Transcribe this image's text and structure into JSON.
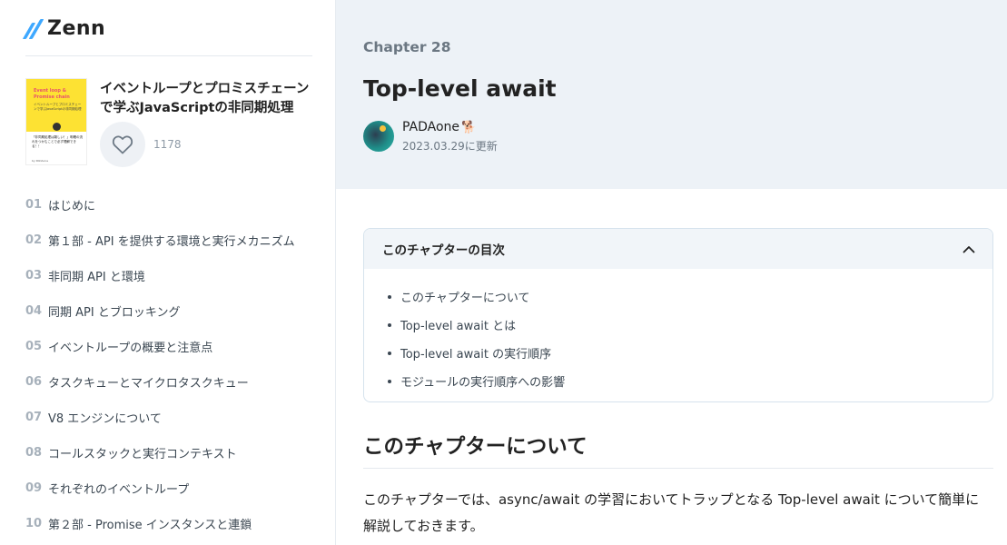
{
  "logo": {
    "text": "Zenn"
  },
  "book": {
    "cover_title": "Event loop & Promise chain",
    "cover_sub": "イベントループとプロミスチェーンで学ぶJavaScriptの非同期処理",
    "cover_quote": "「非同期処理は難しい！」明確の流れをつかむことで必ず理解できる！！",
    "cover_author": "by PADAone",
    "title": "イベントループとプロミスチェーンで学ぶJavaScriptの非同期処理",
    "like_count": "1178"
  },
  "sidebar": {
    "items": [
      {
        "num": "01",
        "label": "はじめに"
      },
      {
        "num": "02",
        "label": "第１部 - API を提供する環境と実行メカニズム"
      },
      {
        "num": "03",
        "label": "非同期 API と環境"
      },
      {
        "num": "04",
        "label": "同期 API とブロッキング"
      },
      {
        "num": "05",
        "label": "イベントループの概要と注意点"
      },
      {
        "num": "06",
        "label": "タスクキューとマイクロタスクキュー"
      },
      {
        "num": "07",
        "label": "V8 エンジンについて"
      },
      {
        "num": "08",
        "label": "コールスタックと実行コンテキスト"
      },
      {
        "num": "09",
        "label": "それぞれのイベントループ"
      },
      {
        "num": "10",
        "label": "第２部 - Promise インスタンスと連鎖"
      }
    ]
  },
  "header": {
    "chapter": "Chapter 28",
    "title": "Top-level await",
    "author_name": "PADAone",
    "author_emoji": "🐕",
    "updated": "2023.03.29に更新"
  },
  "toc": {
    "title": "このチャプターの目次",
    "items": [
      "このチャプターについて",
      "Top-level await とは",
      "Top-level await の実行順序",
      "モジュールの実行順序への影響"
    ]
  },
  "content": {
    "heading": "このチャプターについて",
    "paragraph": "このチャプターでは、async/await の学習においてトラップとなる Top-level await について簡単に解説しておきます。"
  },
  "colors": {
    "brand": "#3ea8ff",
    "header_bg": "#edf2f7",
    "muted": "#6b7782"
  }
}
